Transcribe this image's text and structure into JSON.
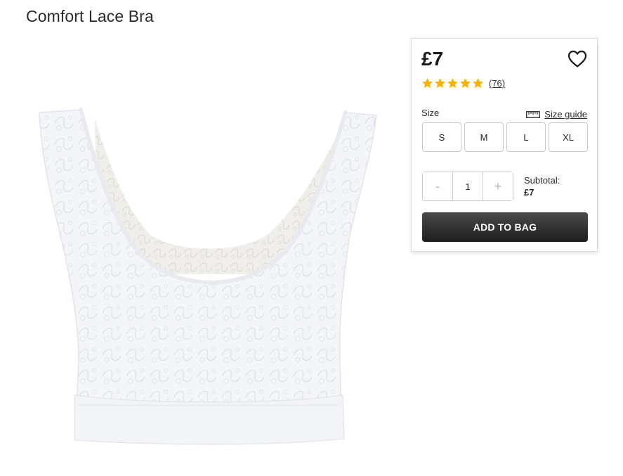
{
  "product": {
    "title": "Comfort Lace Bra",
    "image_alt": "white lace bra"
  },
  "buy_box": {
    "price": "£7",
    "rating": {
      "stars": 5,
      "max_stars": 5,
      "review_count": "(76)",
      "star_color": "#f5b400"
    },
    "size_label": "Size",
    "size_guide_label": "Size guide",
    "sizes": [
      "S",
      "M",
      "L",
      "XL"
    ],
    "quantity": {
      "decrement_label": "-",
      "value": "1",
      "increment_label": "+"
    },
    "subtotal_label": "Subtotal:",
    "subtotal_value": "£7",
    "add_to_bag_label": "ADD TO BAG"
  },
  "icons": {
    "wishlist": "heart-icon",
    "size_guide": "ruler-icon",
    "rating": "star-icon"
  }
}
